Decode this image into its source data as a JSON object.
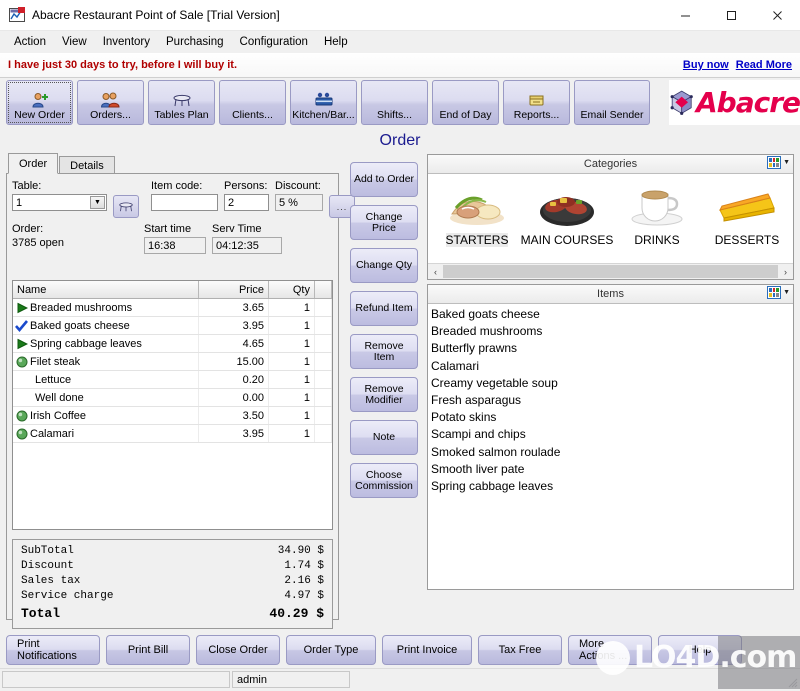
{
  "window": {
    "title": "Abacre Restaurant Point of Sale [Trial Version]",
    "minimize": "–",
    "maximize": "☐",
    "close": "✕"
  },
  "menu": [
    "Action",
    "View",
    "Inventory",
    "Purchasing",
    "Configuration",
    "Help"
  ],
  "trial": {
    "message": "I have just 30 days to try, before I will buy it.",
    "buy_link": "Buy now",
    "read_link": "Read More"
  },
  "toolbar": {
    "buttons": [
      {
        "label": "New Order",
        "icon": "new-order-icon",
        "selected": true
      },
      {
        "label": "Orders...",
        "icon": "orders-icon",
        "selected": false
      },
      {
        "label": "Tables Plan",
        "icon": "table-icon",
        "selected": false
      },
      {
        "label": "Clients...",
        "icon": "clients-icon",
        "selected": false
      },
      {
        "label": "Kitchen/Bar...",
        "icon": "kitchen-bar-icon",
        "selected": false
      },
      {
        "label": "Shifts...",
        "icon": "shifts-icon",
        "selected": false
      },
      {
        "label": "End of Day",
        "icon": "end-of-day-icon",
        "selected": false
      },
      {
        "label": "Reports...",
        "icon": "reports-icon",
        "selected": false
      },
      {
        "label": "Email Sender",
        "icon": "email-sender-icon",
        "selected": false
      }
    ],
    "logo_text": "Abacre"
  },
  "page_title": "Order",
  "tabs": [
    {
      "label": "Order",
      "active": true
    },
    {
      "label": "Details",
      "active": false
    }
  ],
  "order_form": {
    "table_label": "Table:",
    "table_value": "1",
    "item_code_label": "Item code:",
    "item_code_value": "",
    "persons_label": "Persons:",
    "persons_value": "2",
    "discount_label": "Discount:",
    "discount_value": "5 %",
    "discount_more_label": "...",
    "order_label": "Order:",
    "order_value": "3785 open",
    "start_time_label": "Start time",
    "start_time_value": "16:38",
    "serv_time_label": "Serv Time",
    "serv_time_value": "04:12:35",
    "table_picker_icon": "table-icon"
  },
  "order_grid": {
    "columns": [
      "Name",
      "Price",
      "Qty"
    ],
    "rows": [
      {
        "status": "green-arrow",
        "name": "Breaded mushrooms",
        "price": "3.65",
        "qty": "1",
        "modifier": false
      },
      {
        "status": "blue-check",
        "name": "Baked goats cheese",
        "price": "3.95",
        "qty": "1",
        "modifier": false
      },
      {
        "status": "green-arrow",
        "name": "Spring cabbage leaves",
        "price": "4.65",
        "qty": "1",
        "modifier": false
      },
      {
        "status": "green-circle",
        "name": "Filet steak",
        "price": "15.00",
        "qty": "1",
        "modifier": false
      },
      {
        "status": "none",
        "name": "Lettuce",
        "price": "0.20",
        "qty": "1",
        "modifier": true
      },
      {
        "status": "none",
        "name": "Well done",
        "price": "0.00",
        "qty": "1",
        "modifier": true
      },
      {
        "status": "green-circle",
        "name": "Irish Coffee",
        "price": "3.50",
        "qty": "1",
        "modifier": false
      },
      {
        "status": "green-circle",
        "name": "Calamari",
        "price": "3.95",
        "qty": "1",
        "modifier": false
      }
    ]
  },
  "totals": {
    "rows": [
      {
        "label": "SubTotal",
        "value": "34.90 $"
      },
      {
        "label": "Discount",
        "value": "1.74 $"
      },
      {
        "label": "Sales tax",
        "value": "2.16 $"
      },
      {
        "label": "Service charge",
        "value": "4.97 $"
      }
    ],
    "total_label": "Total",
    "total_value": "40.29 $"
  },
  "action_buttons": [
    "Add to Order",
    "Change Price",
    "Change Qty",
    "Refund Item",
    "Remove Item",
    "Remove Modifier",
    "Note",
    "Choose Commission"
  ],
  "categories_panel": {
    "title": "Categories",
    "view_icon": "grid-view-icon",
    "items": [
      {
        "label": "STARTERS",
        "icon": "starters-dish-icon",
        "selected": true
      },
      {
        "label": "MAIN COURSES",
        "icon": "main-courses-dish-icon",
        "selected": false
      },
      {
        "label": "DRINKS",
        "icon": "coffee-cup-icon",
        "selected": false
      },
      {
        "label": "DESSERTS",
        "icon": "cake-slice-icon",
        "selected": false
      }
    ],
    "scroll_left": "‹",
    "scroll_right": "›"
  },
  "items_panel": {
    "title": "Items",
    "view_icon": "grid-view-icon",
    "items": [
      "Baked goats cheese",
      "Breaded mushrooms",
      "Butterfly prawns",
      "Calamari",
      "Creamy vegetable soup",
      "Fresh asparagus",
      "Potato skins",
      "Scampi and chips",
      "Smoked salmon roulade",
      "Smooth liver pate",
      "Spring cabbage leaves"
    ]
  },
  "bottom_buttons": [
    "Print Notifications",
    "Print Bill",
    "Close Order",
    "Order Type",
    "Print Invoice",
    "Tax Free",
    "More Actions ...",
    "Help"
  ],
  "status_bar": {
    "left_cell": "",
    "user_cell": "admin"
  },
  "watermark": "LO4D.com",
  "colors": {
    "accent_blue": "#1b1b8f",
    "trial_red": "#b00000",
    "link_blue": "#0000c8",
    "logo_pink": "#e4004c",
    "button_face": "#c8c8e4"
  }
}
